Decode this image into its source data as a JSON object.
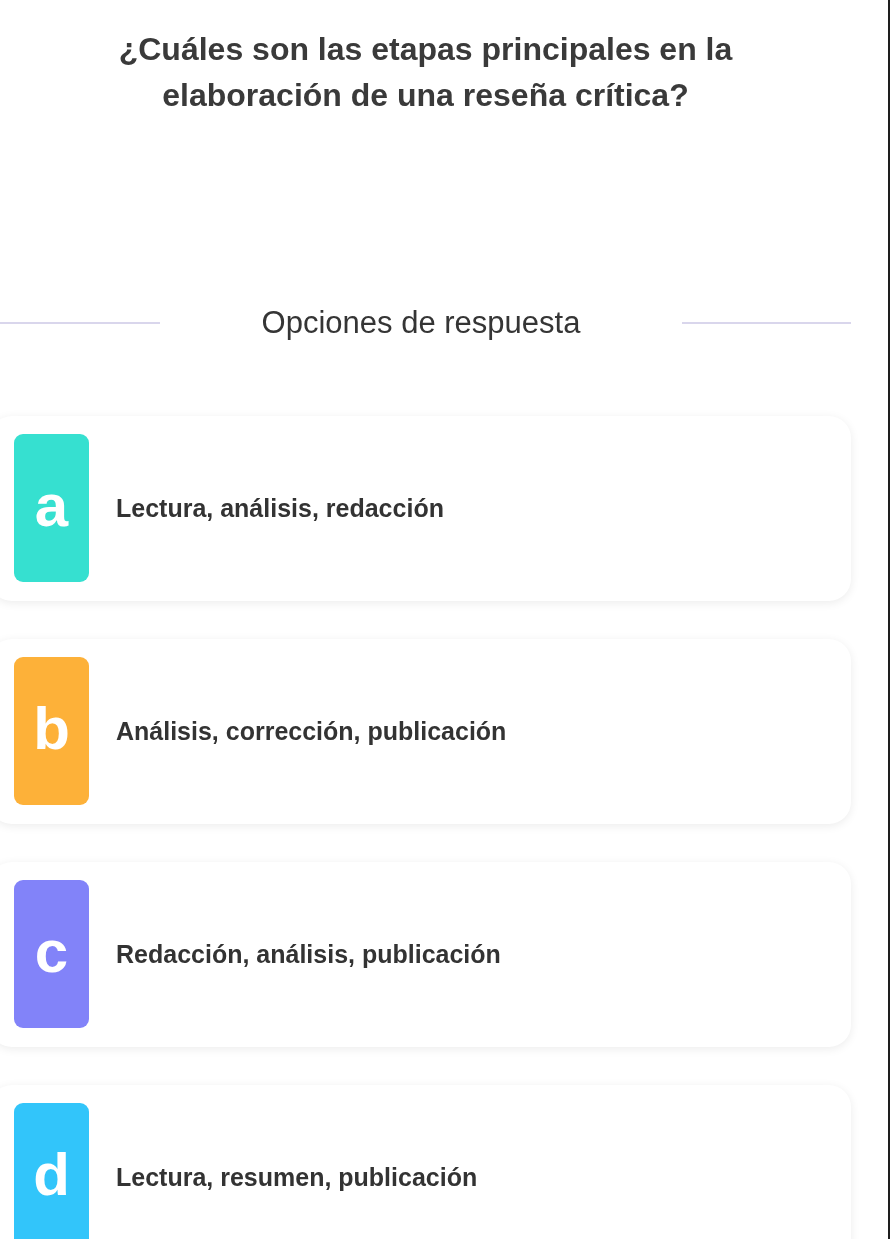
{
  "question": "¿Cuáles son las etapas principales en la elaboración de una reseña crítica?",
  "options_heading": "Opciones de respuesta",
  "options": [
    {
      "letter": "a",
      "text": "Lectura, análisis, redacción",
      "color": "#36e0d0"
    },
    {
      "letter": "b",
      "text": "Análisis, corrección, publicación",
      "color": "#fdb139"
    },
    {
      "letter": "c",
      "text": "Redacción, análisis, publicación",
      "color": "#8283f9"
    },
    {
      "letter": "d",
      "text": "Lectura, resumen, publicación",
      "color": "#32c5fa"
    }
  ]
}
